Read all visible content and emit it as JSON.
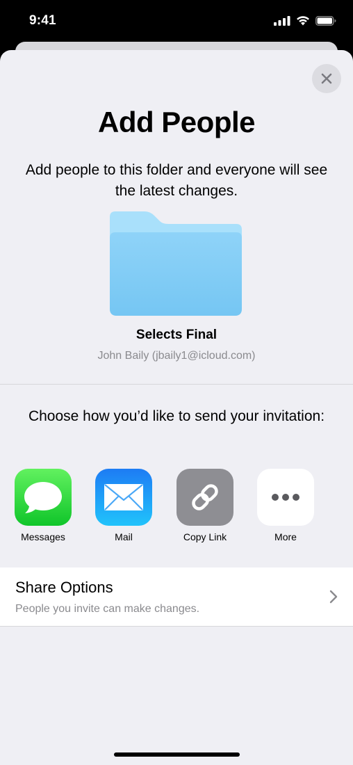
{
  "status": {
    "time": "9:41",
    "icons": [
      "cellular-signal-icon",
      "wifi-icon",
      "battery-icon"
    ]
  },
  "sheet": {
    "close_icon": "close-icon",
    "title": "Add People",
    "subtitle": "Add people to this folder and everyone will see the latest changes.",
    "folder": {
      "icon": "folder-icon",
      "name": "Selects Final",
      "owner": "John Baily (jbaily1@icloud.com)"
    },
    "choose_label": "Choose how you’d like to send your invitation:",
    "share_methods": [
      {
        "label": "Messages",
        "icon": "messages-icon"
      },
      {
        "label": "Mail",
        "icon": "mail-icon"
      },
      {
        "label": "Copy Link",
        "icon": "link-icon"
      },
      {
        "label": "More",
        "icon": "more-icon"
      }
    ],
    "share_options": {
      "title": "Share Options",
      "subtitle": "People you invite can make changes.",
      "icon": "chevron-right-icon"
    }
  },
  "colors": {
    "sheet_bg": "#efeff4",
    "folder_blue": "#7fccf5",
    "messages_green": "#2fd94a",
    "mail_blue": "#1f9cf8",
    "link_gray": "#8e8e93"
  }
}
